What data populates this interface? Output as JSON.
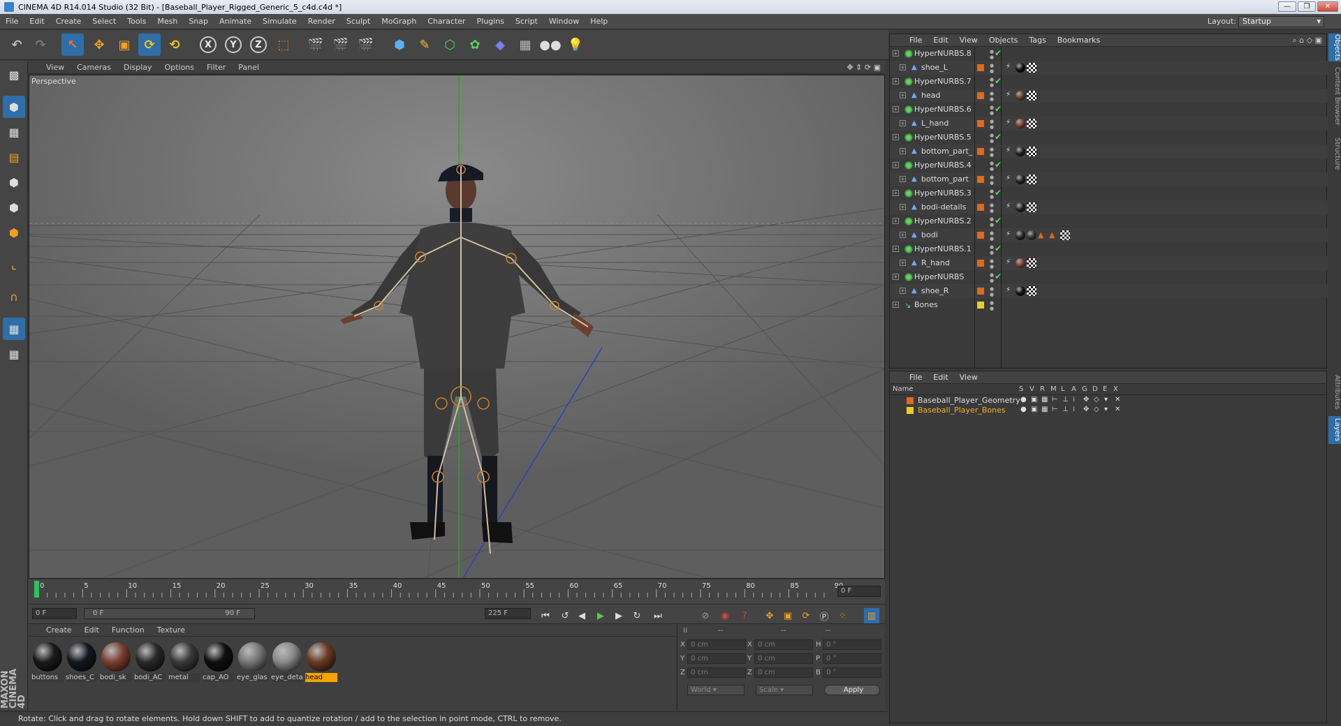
{
  "window": {
    "title": "CINEMA 4D R14.014 Studio (32 Bit) - [Baseball_Player_Rigged_Generic_5_c4d.c4d *]",
    "buttons": [
      "—",
      "❐",
      "✕"
    ]
  },
  "menubar": [
    "File",
    "Edit",
    "Create",
    "Select",
    "Tools",
    "Mesh",
    "Snap",
    "Animate",
    "Simulate",
    "Render",
    "Sculpt",
    "MoGraph",
    "Character",
    "Plugins",
    "Script",
    "Window",
    "Help"
  ],
  "layout": {
    "label": "Layout:",
    "value": "Startup"
  },
  "toolbar": {
    "axes": [
      "X",
      "Y",
      "Z"
    ]
  },
  "viewport": {
    "menu": [
      "View",
      "Cameras",
      "Display",
      "Options",
      "Filter",
      "Panel"
    ],
    "label": "Perspective"
  },
  "timeline": {
    "ticks": [
      "0",
      "5",
      "10",
      "15",
      "20",
      "25",
      "30",
      "35",
      "40",
      "45",
      "50",
      "55",
      "60",
      "65",
      "70",
      "75",
      "80",
      "85",
      "90"
    ],
    "current_frame": "0 F",
    "start_frame": "0 F",
    "range_start": "0 F",
    "range_end": "90 F",
    "end_frame": "225 F"
  },
  "materials": {
    "menu": [
      "Create",
      "Edit",
      "Function",
      "Texture"
    ],
    "items": [
      {
        "label": "buttons",
        "color": "#1a1a1a"
      },
      {
        "label": "shoes_C",
        "color": "#141820"
      },
      {
        "label": "bodi_sk",
        "color": "#7a4030"
      },
      {
        "label": "bodi_AC",
        "color": "#2a2a2a"
      },
      {
        "label": "metal",
        "color": "#3a3a3a"
      },
      {
        "label": "cap_AO",
        "color": "#101010"
      },
      {
        "label": "eye_glas",
        "color": "#777777"
      },
      {
        "label": "eye_deta",
        "color": "#8a8a8a"
      },
      {
        "label": "head",
        "color": "#6a3a25"
      }
    ]
  },
  "coords": {
    "header": [
      "--",
      "--",
      "--"
    ],
    "rows": [
      {
        "a": "X",
        "av": "0 cm",
        "b": "X",
        "bv": "0 cm",
        "c": "H",
        "cv": "0 °"
      },
      {
        "a": "Y",
        "av": "0 cm",
        "b": "Y",
        "bv": "0 cm",
        "c": "P",
        "cv": "0 °"
      },
      {
        "a": "Z",
        "av": "0 cm",
        "b": "Z",
        "bv": "0 cm",
        "c": "B",
        "cv": "0 °"
      }
    ],
    "world": "World",
    "scale": "Scale",
    "apply": "Apply"
  },
  "status": "Rotate: Click and drag to rotate elements. Hold down SHIFT to add to quantize rotation / add to the selection in point mode, CTRL to remove.",
  "brand": "MAXON CINEMA 4D",
  "objects": {
    "menu": [
      "File",
      "Edit",
      "View",
      "Objects",
      "Tags",
      "Bookmarks"
    ],
    "rows": [
      {
        "name": "HyperNURBS.8",
        "child": false,
        "layer": "",
        "tags": []
      },
      {
        "name": "shoe_L",
        "child": true,
        "layer": "#e06a1a",
        "tags": [
          "#111",
          "#ccc"
        ]
      },
      {
        "name": "HyperNURBS.7",
        "child": false,
        "layer": "",
        "tags": []
      },
      {
        "name": "head",
        "child": true,
        "layer": "#e06a1a",
        "tags": [
          "#6a3a25",
          "#ccc"
        ]
      },
      {
        "name": "HyperNURBS.6",
        "child": false,
        "layer": "",
        "tags": []
      },
      {
        "name": "L_hand",
        "child": true,
        "layer": "#e06a1a",
        "tags": [
          "#7a4030",
          "#ccc"
        ]
      },
      {
        "name": "HyperNURBS.5",
        "child": false,
        "layer": "",
        "tags": []
      },
      {
        "name": "bottom_part_",
        "child": true,
        "layer": "#e06a1a",
        "tags": [
          "#222",
          "#ccc"
        ]
      },
      {
        "name": "HyperNURBS.4",
        "child": false,
        "layer": "",
        "tags": []
      },
      {
        "name": "bottom_part",
        "child": true,
        "layer": "#e06a1a",
        "tags": [
          "#222",
          "#ccc"
        ]
      },
      {
        "name": "HyperNURBS.3",
        "child": false,
        "layer": "",
        "tags": []
      },
      {
        "name": "bodi-details",
        "child": true,
        "layer": "#e06a1a",
        "tags": [
          "#222",
          "#ccc"
        ]
      },
      {
        "name": "HyperNURBS.2",
        "child": false,
        "layer": "",
        "tags": []
      },
      {
        "name": "bodi",
        "child": true,
        "layer": "#e06a1a",
        "tags": [
          "#222",
          "#333",
          "▲",
          "▲",
          "#ccc"
        ]
      },
      {
        "name": "HyperNURBS.1",
        "child": false,
        "layer": "",
        "tags": []
      },
      {
        "name": "R_hand",
        "child": true,
        "layer": "#e06a1a",
        "tags": [
          "#7a4030",
          "#ccc"
        ]
      },
      {
        "name": "HyperNURBS",
        "child": false,
        "layer": "",
        "tags": []
      },
      {
        "name": "shoe_R",
        "child": true,
        "layer": "#e06a1a",
        "tags": [
          "#111",
          "#ccc"
        ]
      },
      {
        "name": "Bones",
        "child": false,
        "layer": "#e8d020",
        "tags": [],
        "bone": true
      }
    ]
  },
  "layers": {
    "menu": [
      "File",
      "Edit",
      "View"
    ],
    "columns": [
      "Name",
      "S",
      "V",
      "R",
      "M",
      "L",
      "A",
      "G",
      "D",
      "E",
      "X"
    ],
    "rows": [
      {
        "name": "Baseball_Player_Geometry",
        "color": "#e06a1a",
        "text": "#dddddd"
      },
      {
        "name": "Baseball_Player_Bones",
        "color": "#e8d020",
        "text": "#f0b020"
      }
    ]
  },
  "sidetabs": [
    "Objects",
    "Content Browser",
    "Structure",
    "Attributes",
    "Layers"
  ]
}
